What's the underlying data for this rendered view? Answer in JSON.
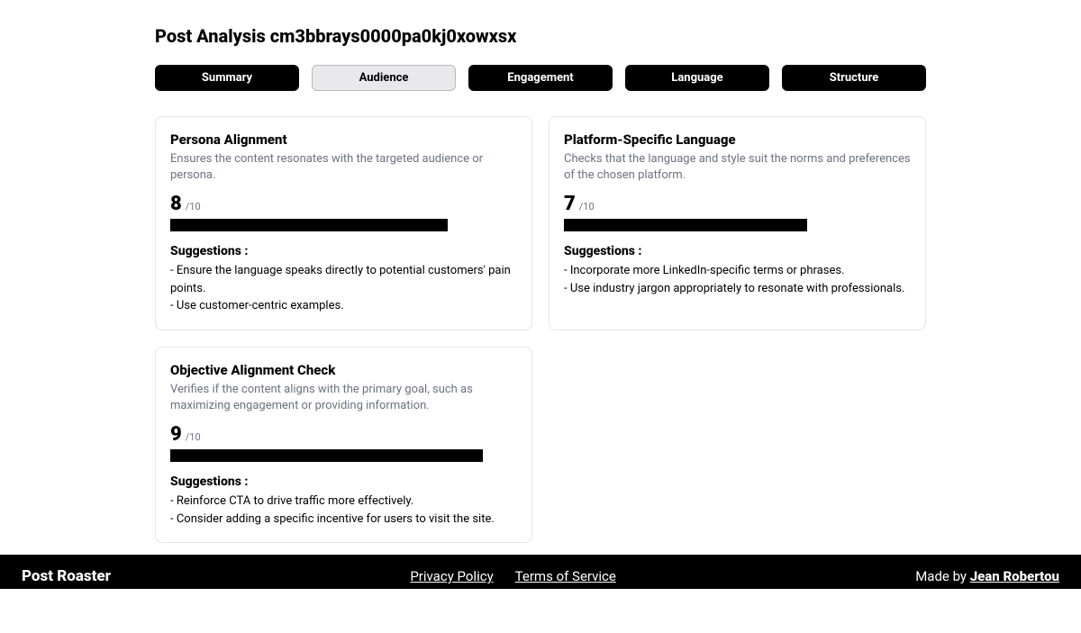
{
  "page": {
    "title": "Post Analysis cm3bbrays0000pa0kj0xowxsx"
  },
  "tabs": [
    {
      "label": "Summary",
      "state": "active"
    },
    {
      "label": "Audience",
      "state": "selected"
    },
    {
      "label": "Engagement",
      "state": "active"
    },
    {
      "label": "Language",
      "state": "active"
    },
    {
      "label": "Structure",
      "state": "active"
    }
  ],
  "cards": [
    {
      "title": "Persona Alignment",
      "desc": "Ensures the content resonates with the targeted audience or persona.",
      "score": "8",
      "denom": "/10",
      "bar_percent": 80,
      "suggestions_label": "Suggestions :",
      "suggestions": [
        "- Ensure the language speaks directly to potential customers' pain points.",
        "- Use customer-centric examples."
      ]
    },
    {
      "title": "Platform-Specific Language",
      "desc": "Checks that the language and style suit the norms and preferences of the chosen platform.",
      "score": "7",
      "denom": "/10",
      "bar_percent": 70,
      "suggestions_label": "Suggestions :",
      "suggestions": [
        "- Incorporate more LinkedIn-specific terms or phrases.",
        "- Use industry jargon appropriately to resonate with professionals."
      ]
    },
    {
      "title": "Objective Alignment Check",
      "desc": "Verifies if the content aligns with the primary goal, such as maximizing engagement or providing information.",
      "score": "9",
      "denom": "/10",
      "bar_percent": 90,
      "suggestions_label": "Suggestions :",
      "suggestions": [
        "- Reinforce CTA to drive traffic more effectively.",
        "- Consider adding a specific incentive for users to visit the site."
      ]
    }
  ],
  "footer": {
    "brand": "Post Roaster",
    "privacy": "Privacy Policy",
    "terms": "Terms of Service",
    "made_by_prefix": "Made by ",
    "author": "Jean Robertou"
  }
}
